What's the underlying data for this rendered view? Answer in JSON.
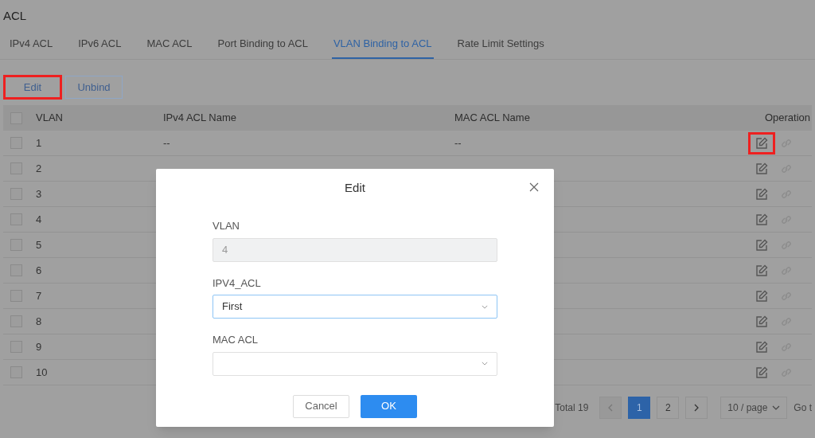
{
  "page_title": "ACL",
  "tabs": [
    {
      "label": "IPv4 ACL",
      "selected": false
    },
    {
      "label": "IPv6 ACL",
      "selected": false
    },
    {
      "label": "MAC ACL",
      "selected": false
    },
    {
      "label": "Port Binding to ACL",
      "selected": false
    },
    {
      "label": "VLAN Binding to ACL",
      "selected": true
    },
    {
      "label": "Rate Limit Settings",
      "selected": false
    }
  ],
  "toolbar": [
    {
      "label": "Edit",
      "highlighted": true
    },
    {
      "label": "Unbind",
      "highlighted": false
    }
  ],
  "table": {
    "select_all_checked": false,
    "columns": [
      "VLAN",
      "IPv4 ACL Name",
      "MAC ACL Name",
      "Operation"
    ],
    "rows": [
      {
        "vlan": "1",
        "ipv4": "--",
        "mac": "--",
        "checked": false,
        "edit_highlighted": true
      },
      {
        "vlan": "2",
        "checked": false,
        "edit_highlighted": false
      },
      {
        "vlan": "3",
        "checked": false,
        "edit_highlighted": false
      },
      {
        "vlan": "4",
        "checked": false,
        "edit_highlighted": false
      },
      {
        "vlan": "5",
        "checked": false,
        "edit_highlighted": false
      },
      {
        "vlan": "6",
        "checked": false,
        "edit_highlighted": false
      },
      {
        "vlan": "7",
        "checked": false,
        "edit_highlighted": false
      },
      {
        "vlan": "8",
        "checked": false,
        "edit_highlighted": false
      },
      {
        "vlan": "9",
        "checked": false,
        "edit_highlighted": false
      },
      {
        "vlan": "10",
        "checked": false,
        "edit_highlighted": false
      }
    ]
  },
  "pagination": {
    "total": "Total 19",
    "pages": [
      {
        "label": "1",
        "selected": true
      },
      {
        "label": "2",
        "selected": false
      }
    ],
    "page_size": "10 / page",
    "goto": "Go t"
  },
  "dialog": {
    "title": "Edit",
    "fields": [
      {
        "label": "VLAN",
        "value": "4",
        "kind": "text",
        "disabled": true
      },
      {
        "label": "IPV4_ACL",
        "value": "First",
        "kind": "select",
        "disabled": false,
        "focused": true
      },
      {
        "label": "MAC ACL",
        "kind": "select",
        "disabled": false,
        "focused": false
      }
    ],
    "buttons": [
      {
        "label": "Cancel",
        "primary": false
      },
      {
        "label": "OK",
        "primary": true
      }
    ]
  }
}
